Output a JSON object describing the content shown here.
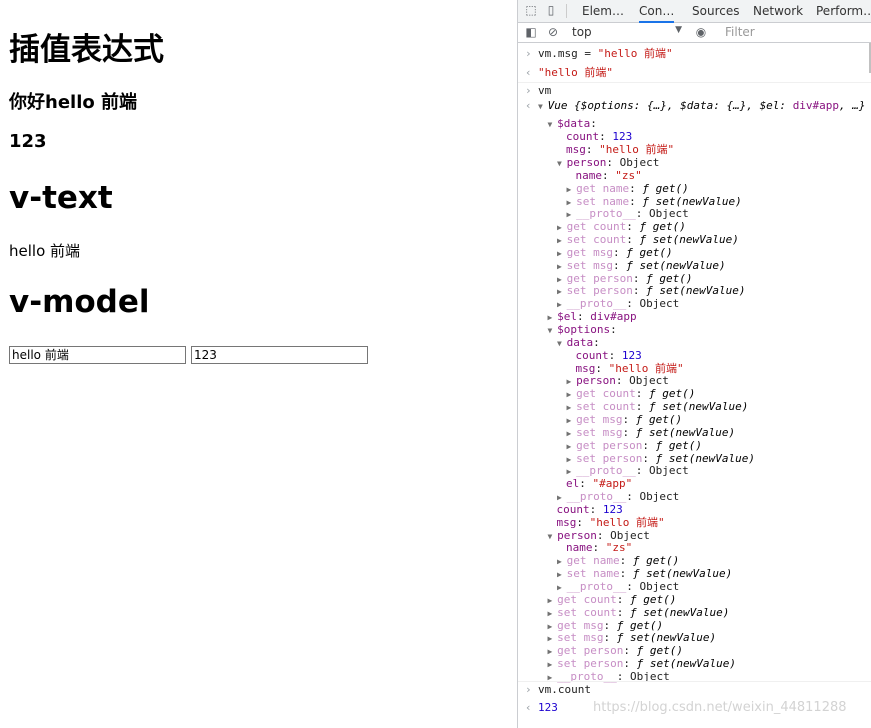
{
  "page": {
    "h_interp": "插值表达式",
    "greeting": "你好hello 前端",
    "count": "123",
    "h_vtext": "v-text",
    "msg": "hello 前端",
    "h_vmodel": "v-model",
    "input_msg": "hello 前端",
    "input_count": "123"
  },
  "devtools": {
    "tabs": [
      "Elem…",
      "Con…",
      "Sources",
      "Network",
      "Perform…"
    ],
    "active_tab": "Con…",
    "context": "top",
    "filter_placeholder": "Filter",
    "lines": [
      {
        "g": ">",
        "parts": [
          [
            "o",
            "vm.msg = "
          ],
          [
            "s",
            "\"hello 前端\""
          ]
        ]
      },
      {
        "g": "<",
        "parts": [
          [
            "s",
            "\"hello 前端\""
          ]
        ]
      },
      {
        "g": ">",
        "parts": [
          [
            "o",
            "vm"
          ]
        ]
      },
      {
        "g": "<",
        "ind": 0,
        "tri": "▼",
        "parts": [
          [
            "it",
            "Vue {$options: {…}, $data: {…}, $el: "
          ],
          [
            "k",
            "div#app"
          ],
          [
            "it",
            ", …}"
          ]
        ]
      },
      {
        "ind": 1,
        "tri": "▼",
        "parts": [
          [
            "k",
            "$data"
          ],
          [
            "o",
            ":"
          ]
        ]
      },
      {
        "ind": 2,
        "parts": [
          [
            "k",
            "count"
          ],
          [
            "o",
            ": "
          ],
          [
            "n",
            "123"
          ]
        ]
      },
      {
        "ind": 2,
        "parts": [
          [
            "k",
            "msg"
          ],
          [
            "o",
            ": "
          ],
          [
            "s",
            "\"hello 前端\""
          ]
        ]
      },
      {
        "ind": 2,
        "tri": "▼",
        "parts": [
          [
            "k",
            "person"
          ],
          [
            "o",
            ": Object"
          ]
        ]
      },
      {
        "ind": 3,
        "parts": [
          [
            "k",
            "name"
          ],
          [
            "o",
            ": "
          ],
          [
            "s",
            "\"zs\""
          ]
        ]
      },
      {
        "ind": 3,
        "tri": "▶",
        "parts": [
          [
            "kg",
            "get name"
          ],
          [
            "o",
            ": "
          ],
          [
            "it",
            "ƒ get()"
          ]
        ]
      },
      {
        "ind": 3,
        "tri": "▶",
        "parts": [
          [
            "kg",
            "set name"
          ],
          [
            "o",
            ": "
          ],
          [
            "it",
            "ƒ set(newValue)"
          ]
        ]
      },
      {
        "ind": 3,
        "tri": "▶",
        "parts": [
          [
            "kg",
            "__proto__"
          ],
          [
            "o",
            ": Object"
          ]
        ]
      },
      {
        "ind": 2,
        "tri": "▶",
        "parts": [
          [
            "kg",
            "get count"
          ],
          [
            "o",
            ": "
          ],
          [
            "it",
            "ƒ get()"
          ]
        ]
      },
      {
        "ind": 2,
        "tri": "▶",
        "parts": [
          [
            "kg",
            "set count"
          ],
          [
            "o",
            ": "
          ],
          [
            "it",
            "ƒ set(newValue)"
          ]
        ]
      },
      {
        "ind": 2,
        "tri": "▶",
        "parts": [
          [
            "kg",
            "get msg"
          ],
          [
            "o",
            ": "
          ],
          [
            "it",
            "ƒ get()"
          ]
        ]
      },
      {
        "ind": 2,
        "tri": "▶",
        "parts": [
          [
            "kg",
            "set msg"
          ],
          [
            "o",
            ": "
          ],
          [
            "it",
            "ƒ set(newValue)"
          ]
        ]
      },
      {
        "ind": 2,
        "tri": "▶",
        "parts": [
          [
            "kg",
            "get person"
          ],
          [
            "o",
            ": "
          ],
          [
            "it",
            "ƒ get()"
          ]
        ]
      },
      {
        "ind": 2,
        "tri": "▶",
        "parts": [
          [
            "kg",
            "set person"
          ],
          [
            "o",
            ": "
          ],
          [
            "it",
            "ƒ set(newValue)"
          ]
        ]
      },
      {
        "ind": 2,
        "tri": "▶",
        "parts": [
          [
            "kg",
            "__proto__"
          ],
          [
            "o",
            ": Object"
          ]
        ]
      },
      {
        "ind": 1,
        "tri": "▶",
        "parts": [
          [
            "k",
            "$el"
          ],
          [
            "o",
            ": "
          ],
          [
            "k",
            "div#app"
          ]
        ]
      },
      {
        "ind": 1,
        "tri": "▼",
        "parts": [
          [
            "k",
            "$options"
          ],
          [
            "o",
            ":"
          ]
        ]
      },
      {
        "ind": 2,
        "tri": "▼",
        "parts": [
          [
            "k",
            "data"
          ],
          [
            "o",
            ":"
          ]
        ]
      },
      {
        "ind": 3,
        "parts": [
          [
            "k",
            "count"
          ],
          [
            "o",
            ": "
          ],
          [
            "n",
            "123"
          ]
        ]
      },
      {
        "ind": 3,
        "parts": [
          [
            "k",
            "msg"
          ],
          [
            "o",
            ": "
          ],
          [
            "s",
            "\"hello 前端\""
          ]
        ]
      },
      {
        "ind": 3,
        "tri": "▶",
        "parts": [
          [
            "k",
            "person"
          ],
          [
            "o",
            ": Object"
          ]
        ]
      },
      {
        "ind": 3,
        "tri": "▶",
        "parts": [
          [
            "kg",
            "get count"
          ],
          [
            "o",
            ": "
          ],
          [
            "it",
            "ƒ get()"
          ]
        ]
      },
      {
        "ind": 3,
        "tri": "▶",
        "parts": [
          [
            "kg",
            "set count"
          ],
          [
            "o",
            ": "
          ],
          [
            "it",
            "ƒ set(newValue)"
          ]
        ]
      },
      {
        "ind": 3,
        "tri": "▶",
        "parts": [
          [
            "kg",
            "get msg"
          ],
          [
            "o",
            ": "
          ],
          [
            "it",
            "ƒ get()"
          ]
        ]
      },
      {
        "ind": 3,
        "tri": "▶",
        "parts": [
          [
            "kg",
            "set msg"
          ],
          [
            "o",
            ": "
          ],
          [
            "it",
            "ƒ set(newValue)"
          ]
        ]
      },
      {
        "ind": 3,
        "tri": "▶",
        "parts": [
          [
            "kg",
            "get person"
          ],
          [
            "o",
            ": "
          ],
          [
            "it",
            "ƒ get()"
          ]
        ]
      },
      {
        "ind": 3,
        "tri": "▶",
        "parts": [
          [
            "kg",
            "set person"
          ],
          [
            "o",
            ": "
          ],
          [
            "it",
            "ƒ set(newValue)"
          ]
        ]
      },
      {
        "ind": 3,
        "tri": "▶",
        "parts": [
          [
            "kg",
            "__proto__"
          ],
          [
            "o",
            ": Object"
          ]
        ]
      },
      {
        "ind": 2,
        "parts": [
          [
            "k",
            "el"
          ],
          [
            "o",
            ": "
          ],
          [
            "s",
            "\"#app\""
          ]
        ]
      },
      {
        "ind": 2,
        "tri": "▶",
        "parts": [
          [
            "kg",
            "__proto__"
          ],
          [
            "o",
            ": Object"
          ]
        ]
      },
      {
        "ind": 1,
        "parts": [
          [
            "k",
            "count"
          ],
          [
            "o",
            ": "
          ],
          [
            "n",
            "123"
          ]
        ]
      },
      {
        "ind": 1,
        "parts": [
          [
            "k",
            "msg"
          ],
          [
            "o",
            ": "
          ],
          [
            "s",
            "\"hello 前端\""
          ]
        ]
      },
      {
        "ind": 1,
        "tri": "▼",
        "parts": [
          [
            "k",
            "person"
          ],
          [
            "o",
            ": Object"
          ]
        ]
      },
      {
        "ind": 2,
        "parts": [
          [
            "k",
            "name"
          ],
          [
            "o",
            ": "
          ],
          [
            "s",
            "\"zs\""
          ]
        ]
      },
      {
        "ind": 2,
        "tri": "▶",
        "parts": [
          [
            "kg",
            "get name"
          ],
          [
            "o",
            ": "
          ],
          [
            "it",
            "ƒ get()"
          ]
        ]
      },
      {
        "ind": 2,
        "tri": "▶",
        "parts": [
          [
            "kg",
            "set name"
          ],
          [
            "o",
            ": "
          ],
          [
            "it",
            "ƒ set(newValue)"
          ]
        ]
      },
      {
        "ind": 2,
        "tri": "▶",
        "parts": [
          [
            "kg",
            "__proto__"
          ],
          [
            "o",
            ": Object"
          ]
        ]
      },
      {
        "ind": 1,
        "tri": "▶",
        "parts": [
          [
            "kg",
            "get count"
          ],
          [
            "o",
            ": "
          ],
          [
            "it",
            "ƒ get()"
          ]
        ]
      },
      {
        "ind": 1,
        "tri": "▶",
        "parts": [
          [
            "kg",
            "set count"
          ],
          [
            "o",
            ": "
          ],
          [
            "it",
            "ƒ set(newValue)"
          ]
        ]
      },
      {
        "ind": 1,
        "tri": "▶",
        "parts": [
          [
            "kg",
            "get msg"
          ],
          [
            "o",
            ": "
          ],
          [
            "it",
            "ƒ get()"
          ]
        ]
      },
      {
        "ind": 1,
        "tri": "▶",
        "parts": [
          [
            "kg",
            "set msg"
          ],
          [
            "o",
            ": "
          ],
          [
            "it",
            "ƒ set(newValue)"
          ]
        ]
      },
      {
        "ind": 1,
        "tri": "▶",
        "parts": [
          [
            "kg",
            "get person"
          ],
          [
            "o",
            ": "
          ],
          [
            "it",
            "ƒ get()"
          ]
        ]
      },
      {
        "ind": 1,
        "tri": "▶",
        "parts": [
          [
            "kg",
            "set person"
          ],
          [
            "o",
            ": "
          ],
          [
            "it",
            "ƒ set(newValue)"
          ]
        ]
      },
      {
        "ind": 1,
        "tri": "▶",
        "parts": [
          [
            "kg",
            "__proto__"
          ],
          [
            "o",
            ": Object"
          ]
        ]
      },
      {
        "g": ">",
        "parts": [
          [
            "o",
            "vm.count"
          ]
        ]
      },
      {
        "g": "<",
        "parts": [
          [
            "n",
            "123"
          ]
        ]
      }
    ],
    "watermark": "https://blog.csdn.net/weixin_44811288"
  }
}
